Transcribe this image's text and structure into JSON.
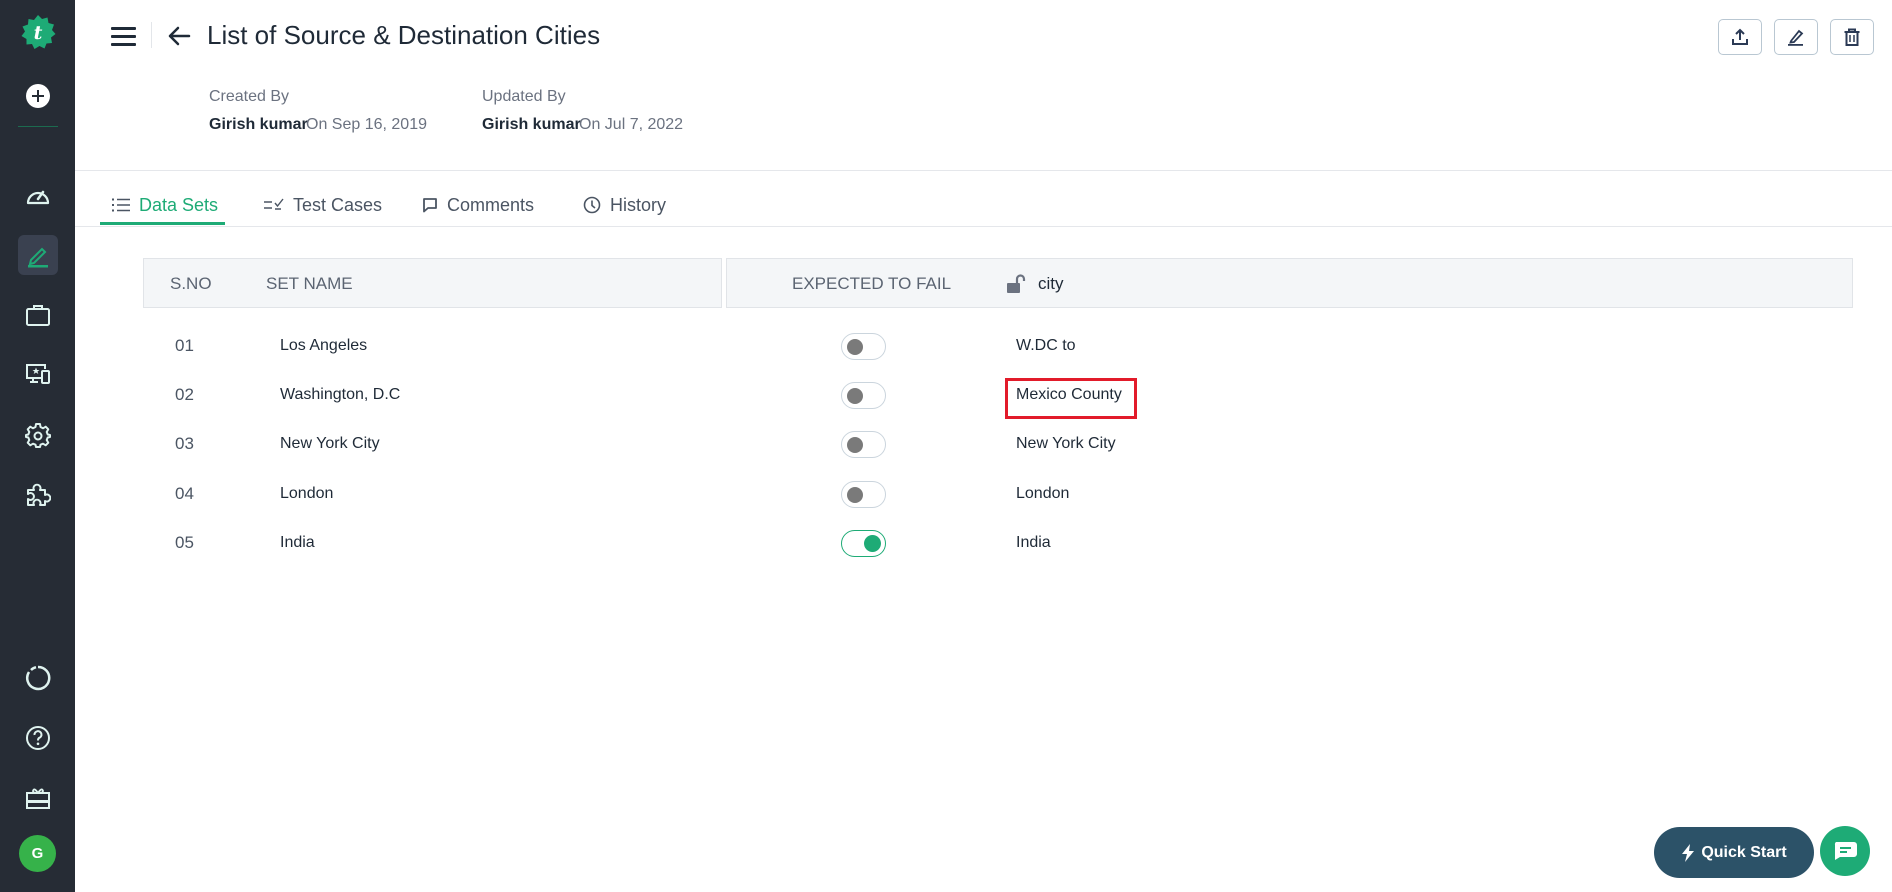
{
  "sidebar": {
    "logo_letter": "t",
    "items": [
      {
        "name": "create",
        "icon": "plus-circle-icon"
      },
      {
        "name": "dashboard",
        "icon": "speedometer-icon"
      },
      {
        "name": "test-design",
        "icon": "pencil-icon",
        "active": true
      },
      {
        "name": "projects",
        "icon": "briefcase-icon"
      },
      {
        "name": "devices",
        "icon": "monitor-star-icon"
      },
      {
        "name": "settings",
        "icon": "gear-icon"
      },
      {
        "name": "addons",
        "icon": "puzzle-icon"
      },
      {
        "name": "loading",
        "icon": "loader-ring-icon"
      },
      {
        "name": "help",
        "icon": "question-circle-icon"
      },
      {
        "name": "whats-new",
        "icon": "gift-icon"
      }
    ],
    "avatar_initial": "G"
  },
  "header": {
    "title": "List of Source & Destination Cities",
    "created_label": "Created By",
    "created_by": "Girish kumar",
    "created_on": "On Sep 16, 2019",
    "updated_label": "Updated By",
    "updated_by": "Girish kumar",
    "updated_on": "On Jul 7, 2022",
    "actions": [
      "export",
      "edit",
      "delete"
    ]
  },
  "tabs": [
    {
      "label": "Data Sets",
      "icon": "list-icon",
      "active": true
    },
    {
      "label": "Test Cases",
      "icon": "checklist-icon"
    },
    {
      "label": "Comments",
      "icon": "comment-icon"
    },
    {
      "label": "History",
      "icon": "clock-icon"
    }
  ],
  "table": {
    "columns": {
      "sno": "S.NO",
      "set_name": "SET NAME",
      "expected_to_fail": "EXPECTED TO FAIL",
      "param": "city"
    },
    "rows": [
      {
        "sno": "01",
        "name": "Los Angeles",
        "expected_to_fail": false,
        "city": "W.DC to"
      },
      {
        "sno": "02",
        "name": "Washington, D.C",
        "expected_to_fail": false,
        "city": "Mexico County",
        "highlighted": true
      },
      {
        "sno": "03",
        "name": "New York City",
        "expected_to_fail": false,
        "city": "New York City"
      },
      {
        "sno": "04",
        "name": "London",
        "expected_to_fail": false,
        "city": "London"
      },
      {
        "sno": "05",
        "name": "India",
        "expected_to_fail": true,
        "city": "India"
      }
    ]
  },
  "footer": {
    "quick_start_label": "Quick Start"
  },
  "colors": {
    "accent": "#1eab76",
    "sidebar_bg": "#262c35",
    "quick_start_bg": "#2c5268",
    "highlight": "#e21b2a"
  }
}
